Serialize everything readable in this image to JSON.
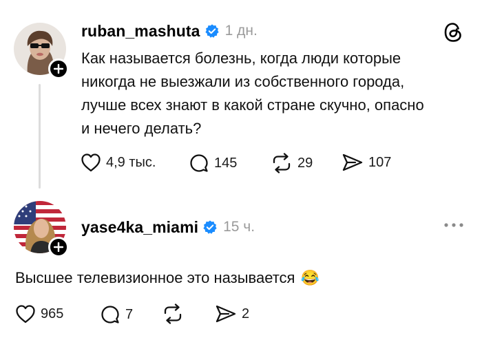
{
  "post1": {
    "username": "ruban_mashuta",
    "time": "1 дн.",
    "text_lines": [
      "Как называется болезнь, когда люди которые",
      "никогда не выезжали из собственного города,",
      "лучше всех знают в какой стране скучно, опасно",
      "и нечего делать?"
    ],
    "likes": "4,9 тыс.",
    "comments": "145",
    "reposts": "29",
    "shares": "107"
  },
  "post2": {
    "username": "yase4ka_miami",
    "time": "15 ч.",
    "text": "Высшее телевизионное это называется",
    "emoji": "😂",
    "likes": "965",
    "comments": "7",
    "shares": "2"
  },
  "icons": {
    "verified": "verified-badge-icon",
    "threads_logo": "threads-logo-icon",
    "more": "more-options-icon",
    "like": "heart-icon",
    "comment": "comment-bubble-icon",
    "repost": "repost-icon",
    "share": "send-icon",
    "follow": "plus-icon"
  },
  "colors": {
    "verified": "#1a8cff",
    "muted": "#9a9a9a",
    "thread_line": "#dcdcdc"
  }
}
